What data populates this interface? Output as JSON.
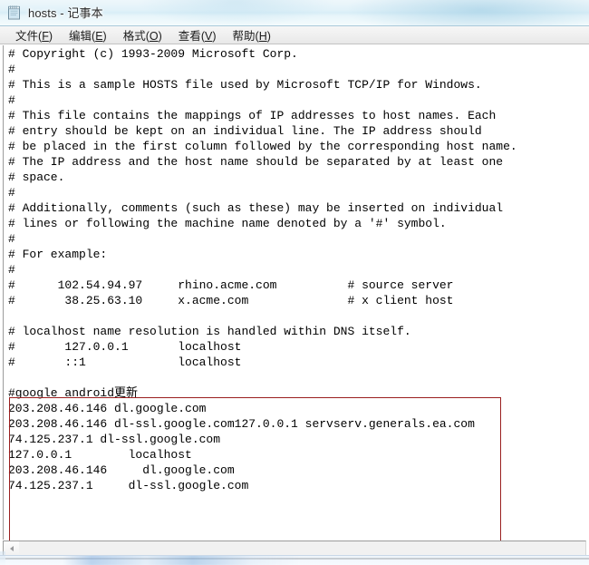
{
  "window": {
    "title": "hosts - 记事本",
    "icon": "notepad-icon"
  },
  "menu_bar": {
    "items": [
      {
        "label": "文件",
        "accel": "F"
      },
      {
        "label": "编辑",
        "accel": "E"
      },
      {
        "label": "格式",
        "accel": "O"
      },
      {
        "label": "查看",
        "accel": "V"
      },
      {
        "label": "帮助",
        "accel": "H"
      }
    ]
  },
  "editor": {
    "text": "# Copyright (c) 1993-2009 Microsoft Corp.\n#\n# This is a sample HOSTS file used by Microsoft TCP/IP for Windows.\n#\n# This file contains the mappings of IP addresses to host names. Each\n# entry should be kept on an individual line. The IP address should\n# be placed in the first column followed by the corresponding host name.\n# The IP address and the host name should be separated by at least one\n# space.\n#\n# Additionally, comments (such as these) may be inserted on individual\n# lines or following the machine name denoted by a '#' symbol.\n#\n# For example:\n#\n#      102.54.94.97     rhino.acme.com          # source server\n#       38.25.63.10     x.acme.com              # x client host\n\n# localhost name resolution is handled within DNS itself.\n#       127.0.0.1       localhost\n#       ::1             localhost\n\n#google_android更新\n203.208.46.146 dl.google.com\n203.208.46.146 dl-ssl.google.com127.0.0.1 servserv.generals.ea.com\n74.125.237.1 dl-ssl.google.com\n127.0.0.1        localhost\n203.208.46.146     dl.google.com\n74.125.237.1     dl-ssl.google.com",
    "highlighted_lines": [
      "#google_android更新",
      "203.208.46.146 dl.google.com",
      "203.208.46.146 dl-ssl.google.com127.0.0.1 servserv.generals.ea.com",
      "74.125.237.1 dl-ssl.google.com",
      "127.0.0.1        localhost",
      "203.208.46.146     dl.google.com",
      "74.125.237.1     dl-ssl.google.com"
    ]
  },
  "annotation": {
    "color": "#9a1f1f",
    "shape": "rectangle"
  },
  "scrollbar": {
    "orientation": "horizontal",
    "left_arrow": "◄"
  }
}
